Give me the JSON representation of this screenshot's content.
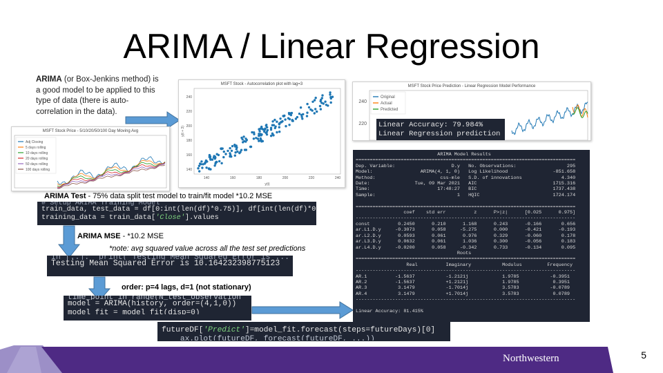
{
  "slide": {
    "title": "ARIMA / Linear Regression",
    "page_number": "5",
    "logo_text": "Northwestern"
  },
  "intro": {
    "term": "ARIMA",
    "text": " (or Box-Jenkins method) is a good model to be applied to this type of data (there is auto-correlation in the data)."
  },
  "moving_avg_chart": {
    "title": "MSFT Stock Price - 5/10/20/50/100 Day Moving Avg",
    "legend": [
      "Adj Closing",
      "5 days rolling",
      "10 days rolling",
      "20 days rolling",
      "50 days rolling",
      "100 days rolling"
    ],
    "colors": [
      "#1f77b4",
      "#ff7f0e",
      "#2ca02c",
      "#d62728",
      "#9467bd",
      "#8c564b"
    ]
  },
  "autocorr_chart": {
    "title": "MSFT Stock - Autocorrelation plot with lag=3",
    "xlabel": "y(t)",
    "ylabel": "y(t + 3)",
    "x_ticks": [
      "140",
      "160",
      "180",
      "200",
      "220",
      "240"
    ],
    "y_ticks": [
      "240",
      "220",
      "200",
      "180",
      "160",
      "140"
    ]
  },
  "lr_chart": {
    "title": "MSFT Stock Price Prediction - Linear Regression Model Performance",
    "legend": [
      "Original",
      "Actual",
      "Predicted"
    ],
    "colors": [
      "#1f77b4",
      "#ff7f0e",
      "#2ca02c"
    ],
    "y_ticks": [
      "240",
      "220"
    ],
    "overlay_line1": "Linear Accuracy: 79.984%",
    "overlay_line2": "Linear Regression prediction ="
  },
  "arima_test": {
    "label_bold": "ARIMA Test",
    "label_rest": " -  75% data split test model to train/fit model *10.2 MSE",
    "code_line0": "# Setup ARIMA Training Model",
    "code_line1": "train_data, test_data = df[0:int(len(df)*0.75)], df[int(len(df)*0.75):]",
    "code_line2a": "training_data = train_data[",
    "code_line2b": "'Close'",
    "code_line2c": "].values"
  },
  "arima_mse": {
    "label_bold": "ARIMA  MSE",
    "label_rest": " -  *10.2 MSE",
    "note": "*note: avg squared value across all the test set predictions",
    "code_line0": "In [..]:  print('Testing Mean Squared Error is ...')",
    "code_line1": "Testing Mean Squared Error is 10.164232398775123"
  },
  "order": {
    "label": "order: p=4 lags, d=1 (not stationary)",
    "code_line0": "time_point in range(N_test_observation",
    "code_line1": "model = ARIMA(history, order=(4,1,0))",
    "code_line2": "model_fit = model_fit(disp=0)"
  },
  "forecast": {
    "code_line0a": "futureDF[",
    "code_line0b": "'Predict'",
    "code_line0c": "]=model_fit.forecast(steps=futureDays)[0]",
    "code_line1": "    ax.plot(futureDF, forecast(futureDF, ...))"
  },
  "arima_results": {
    "lines": [
      "                             ARIMA Model Results",
      "==============================================================================",
      "Dep. Variable:                    D.y   No. Observations:                  295",
      "Model:                 ARIMA(4, 1, 0)   Log Likelihood                -851.658",
      "Method:                       css-mle   S.D. of innovations              4.340",
      "Date:                Tue, 09 Mar 2021   AIC                           1715.316",
      "Time:                        17:48:27   BIC                           1737.438",
      "Sample:                             1   HQIC                          1724.174",
      "",
      "==============================================================================",
      "                 coef    std err          z      P>|z|      [0.025      0.975]",
      "------------------------------------------------------------------------------",
      "const          0.2450      0.210      1.168      0.243      -0.166       0.656",
      "ar.L1.D.y     -0.3073      0.058     -5.275      0.000      -0.421      -0.193",
      "ar.L2.D.y      0.0593      0.061      0.976      0.329      -0.060       0.178",
      "ar.L3.D.y      0.0632      0.061      1.036      0.300      -0.056       0.183",
      "ar.L4.D.y     -0.0200      0.058     -0.342      0.733      -0.134       0.095",
      "                                    Roots",
      "==============================================================================",
      "                  Real          Imaginary           Modulus         Frequency",
      "------------------------------------------------------------------------------",
      "AR.1          -1.5637           -1.2121j            1.9785           -0.3951",
      "AR.2          -1.5637           +1.2121j            1.9785            0.3951",
      "AR.3           3.1479           -1.7014j            3.5783           -0.0789",
      "AR.4           3.1479           +1.7014j            3.5783            0.0789",
      "------------------------------------------------------------------------------",
      "",
      "Linear Accuracy: 81.415%"
    ]
  }
}
